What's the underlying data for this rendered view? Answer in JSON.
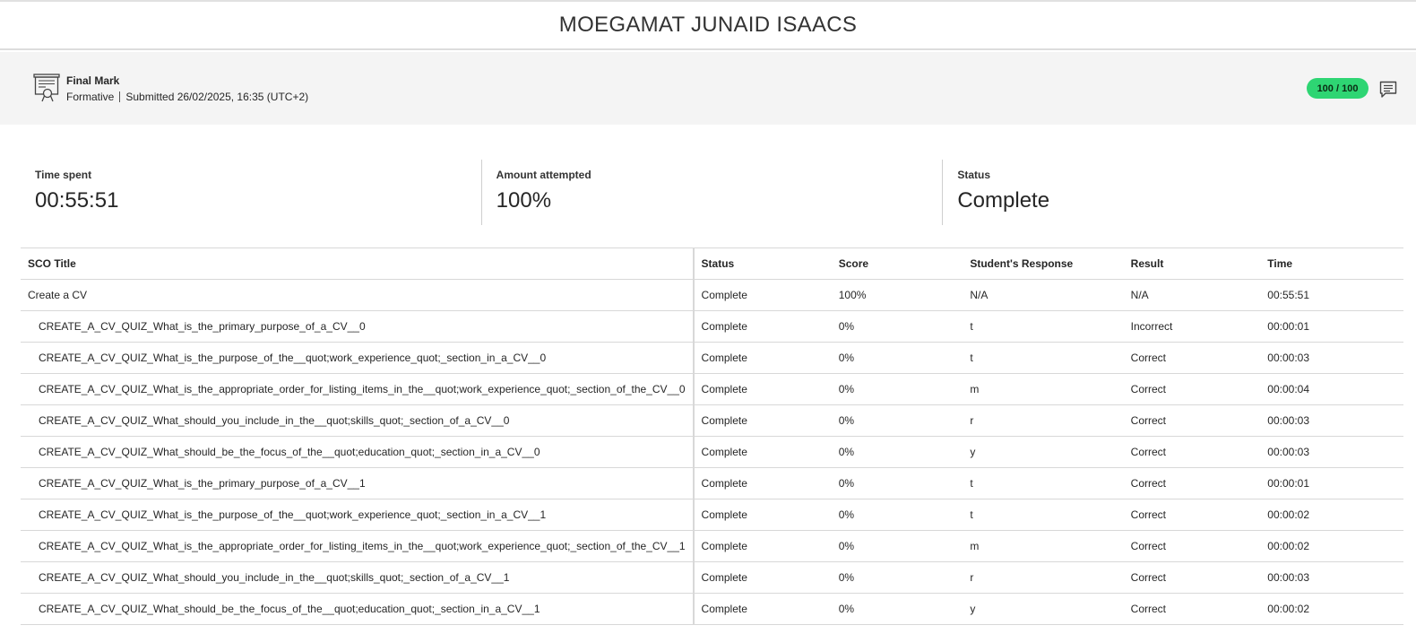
{
  "page": {
    "student_name": "MOEGAMAT JUNAID ISAACS"
  },
  "grade": {
    "title": "Final Mark",
    "type": "Formative",
    "submitted": "Submitted 26/02/2025, 16:35 (UTC+2)",
    "score": "100 / 100",
    "icon": "certificate-icon",
    "feedback_icon": "comment-icon",
    "score_color": "#2ed573"
  },
  "stats": {
    "time_spent_label": "Time spent",
    "time_spent_value": "00:55:51",
    "attempted_label": "Amount attempted",
    "attempted_value": "100%",
    "status_label": "Status",
    "status_value": "Complete"
  },
  "table": {
    "headers": [
      "SCO Title",
      "Status",
      "Score",
      "Student's Response",
      "Result",
      "Time"
    ],
    "rows": [
      {
        "title": "Create a CV",
        "status": "Complete",
        "score": "100%",
        "response": "N/A",
        "result": "N/A",
        "time": "00:55:51"
      },
      {
        "title": "CREATE_A_CV_QUIZ_What_is_the_primary_purpose_of_a_CV__0",
        "status": "Complete",
        "score": "0%",
        "response": "t",
        "result": "Incorrect",
        "time": "00:00:01"
      },
      {
        "title": "CREATE_A_CV_QUIZ_What_is_the_purpose_of_the__quot;work_experience_quot;_section_in_a_CV__0",
        "status": "Complete",
        "score": "0%",
        "response": "t",
        "result": "Correct",
        "time": "00:00:03"
      },
      {
        "title": "CREATE_A_CV_QUIZ_What_is_the_appropriate_order_for_listing_items_in_the__quot;work_experience_quot;_section_of_the_CV__0",
        "status": "Complete",
        "score": "0%",
        "response": "m",
        "result": "Correct",
        "time": "00:00:04"
      },
      {
        "title": "CREATE_A_CV_QUIZ_What_should_you_include_in_the__quot;skills_quot;_section_of_a_CV__0",
        "status": "Complete",
        "score": "0%",
        "response": "r",
        "result": "Correct",
        "time": "00:00:03"
      },
      {
        "title": "CREATE_A_CV_QUIZ_What_should_be_the_focus_of_the__quot;education_quot;_section_in_a_CV__0",
        "status": "Complete",
        "score": "0%",
        "response": "y",
        "result": "Correct",
        "time": "00:00:03"
      },
      {
        "title": "CREATE_A_CV_QUIZ_What_is_the_primary_purpose_of_a_CV__1",
        "status": "Complete",
        "score": "0%",
        "response": "t",
        "result": "Correct",
        "time": "00:00:01"
      },
      {
        "title": "CREATE_A_CV_QUIZ_What_is_the_purpose_of_the__quot;work_experience_quot;_section_in_a_CV__1",
        "status": "Complete",
        "score": "0%",
        "response": "t",
        "result": "Correct",
        "time": "00:00:02"
      },
      {
        "title": "CREATE_A_CV_QUIZ_What_is_the_appropriate_order_for_listing_items_in_the__quot;work_experience_quot;_section_of_the_CV__1",
        "status": "Complete",
        "score": "0%",
        "response": "m",
        "result": "Correct",
        "time": "00:00:02"
      },
      {
        "title": "CREATE_A_CV_QUIZ_What_should_you_include_in_the__quot;skills_quot;_section_of_a_CV__1",
        "status": "Complete",
        "score": "0%",
        "response": "r",
        "result": "Correct",
        "time": "00:00:03"
      },
      {
        "title": "CREATE_A_CV_QUIZ_What_should_be_the_focus_of_the__quot;education_quot;_section_in_a_CV__1",
        "status": "Complete",
        "score": "0%",
        "response": "y",
        "result": "Correct",
        "time": "00:00:02"
      }
    ]
  }
}
